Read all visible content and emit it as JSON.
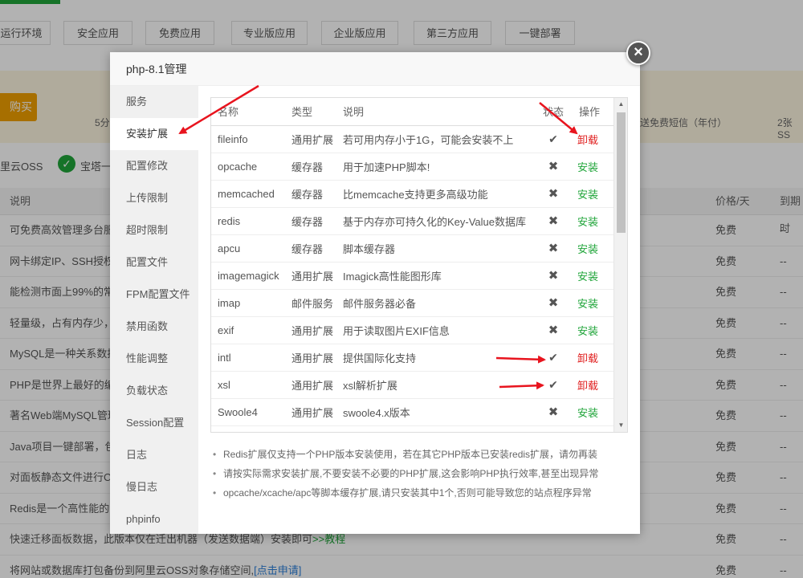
{
  "background": {
    "tabs": [
      "运行环境",
      "安全应用",
      "免费应用",
      "专业版应用",
      "企业版应用",
      "第三方应用",
      "一键部署"
    ],
    "buy_label": "购买",
    "banner": {
      "left": "5分",
      "mid": "送免费短信（年付）",
      "right": "2张SS"
    },
    "filters": {
      "oss": "里云OSS",
      "bt": "宝塔一"
    },
    "columns": {
      "desc": "说明",
      "price": "价格/天",
      "expire": "到期时"
    },
    "rows": [
      {
        "desc": "可免费高效管理多台服务",
        "price": "免费",
        "expire": "--"
      },
      {
        "desc": "网卡绑定IP、SSH授权II",
        "price": "免费",
        "expire": "--"
      },
      {
        "desc": "能检测市面上99%的常见",
        "price": "免费",
        "expire": "--"
      },
      {
        "desc": "轻量级，占有内存少，并",
        "price": "免费",
        "expire": "--"
      },
      {
        "desc": "MySQL是一种关系数据",
        "price": "免费",
        "expire": "--"
      },
      {
        "desc": "PHP是世界上最好的编",
        "price": "免费",
        "expire": "--"
      },
      {
        "desc": "著名Web端MySQL管理",
        "price": "免费",
        "expire": "--"
      },
      {
        "desc": "Java项目一键部署，包括",
        "price": "免费",
        "expire": "--"
      },
      {
        "desc": "对面板静态文件进行CD",
        "price": "免费",
        "expire": "--"
      },
      {
        "desc": "Redis是一个高性能的ke",
        "price": "免费",
        "expire": "--"
      },
      {
        "desc": "快速迁移面板数据，此版本仅在迁出机器（发送数据端）安装即可",
        "link": ">>教程",
        "price": "免费",
        "expire": "--"
      },
      {
        "desc": "将网站或数据库打包备份到阿里云OSS对象存储空间,",
        "link": "[点击申请]",
        "price": "免费",
        "expire": "--"
      }
    ]
  },
  "modal": {
    "title": "php-8.1管理",
    "close": "×",
    "sidebar": [
      "服务",
      "安装扩展",
      "配置修改",
      "上传限制",
      "超时限制",
      "配置文件",
      "FPM配置文件",
      "禁用函数",
      "性能调整",
      "负载状态",
      "Session配置",
      "日志",
      "慢日志",
      "phpinfo"
    ],
    "active_index": 1,
    "table": {
      "headers": {
        "name": "名称",
        "type": "类型",
        "desc": "说明",
        "status": "状态",
        "op": "操作"
      },
      "rows": [
        {
          "name": "fileinfo",
          "type": "通用扩展",
          "desc": "若可用内存小于1G，可能会安装不上",
          "installed": true,
          "op": "卸载"
        },
        {
          "name": "opcache",
          "type": "缓存器",
          "desc": "用于加速PHP脚本!",
          "installed": false,
          "op": "安装"
        },
        {
          "name": "memcached",
          "type": "缓存器",
          "desc": "比memcache支持更多高级功能",
          "installed": false,
          "op": "安装"
        },
        {
          "name": "redis",
          "type": "缓存器",
          "desc": "基于内存亦可持久化的Key-Value数据库",
          "installed": false,
          "op": "安装"
        },
        {
          "name": "apcu",
          "type": "缓存器",
          "desc": "脚本缓存器",
          "installed": false,
          "op": "安装"
        },
        {
          "name": "imagemagick",
          "type": "通用扩展",
          "desc": "Imagick高性能图形库",
          "installed": false,
          "op": "安装"
        },
        {
          "name": "imap",
          "type": "邮件服务",
          "desc": "邮件服务器必备",
          "installed": false,
          "op": "安装"
        },
        {
          "name": "exif",
          "type": "通用扩展",
          "desc": "用于读取图片EXIF信息",
          "installed": false,
          "op": "安装"
        },
        {
          "name": "intl",
          "type": "通用扩展",
          "desc": "提供国际化支持",
          "installed": true,
          "op": "卸载"
        },
        {
          "name": "xsl",
          "type": "通用扩展",
          "desc": "xsl解析扩展",
          "installed": true,
          "op": "卸载"
        },
        {
          "name": "Swoole4",
          "type": "通用扩展",
          "desc": "swoole4.x版本",
          "installed": false,
          "op": "安装"
        }
      ]
    },
    "tips": [
      "Redis扩展仅支持一个PHP版本安装使用，若在其它PHP版本已安装redis扩展，请勿再装",
      "请按实际需求安装扩展,不要安装不必要的PHP扩展,这会影响PHP执行效率,甚至出现异常",
      "opcache/xcache/apc等脚本缓存扩展,请只安装其中1个,否则可能导致您的站点程序异常"
    ],
    "icons": {
      "installed": "check-icon",
      "not_installed": "cross-icon"
    }
  },
  "colors": {
    "accent": "#20a53a",
    "danger": "#e02020",
    "annotation": "#e8141e",
    "buy": "#f0a000"
  }
}
